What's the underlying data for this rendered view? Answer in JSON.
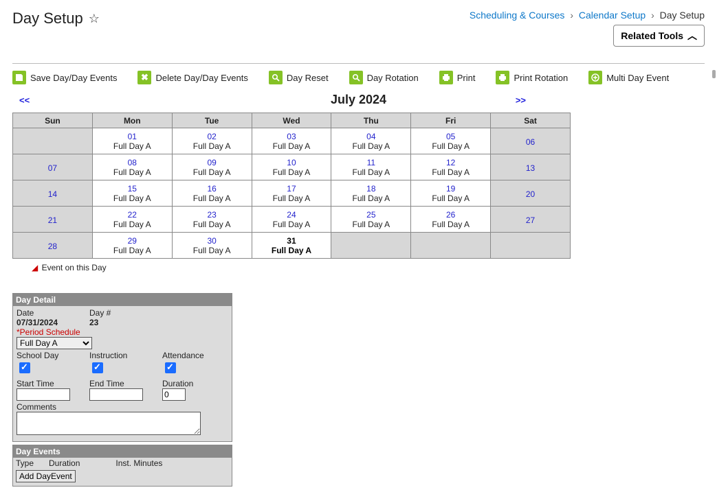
{
  "page_title": "Day Setup",
  "breadcrumb": {
    "scheduling": "Scheduling & Courses",
    "calendar_setup": "Calendar Setup",
    "day_setup": "Day Setup"
  },
  "related_tools_label": "Related Tools",
  "toolbar": {
    "save": "Save Day/Day Events",
    "delete": "Delete Day/Day Events",
    "day_reset": "Day Reset",
    "day_rotation": "Day Rotation",
    "print": "Print",
    "print_rotation": "Print Rotation",
    "multi_day_event": "Multi Day Event"
  },
  "calendar": {
    "month_label": "July 2024",
    "prev_symbol": "<<",
    "next_symbol": ">>",
    "weekdays": [
      "Sun",
      "Mon",
      "Tue",
      "Wed",
      "Thu",
      "Fri",
      "Sat"
    ],
    "weeks": [
      [
        {
          "n": "",
          "label": "",
          "weekend": true
        },
        {
          "n": "01",
          "label": "Full Day A"
        },
        {
          "n": "02",
          "label": "Full Day A"
        },
        {
          "n": "03",
          "label": "Full Day A"
        },
        {
          "n": "04",
          "label": "Full Day A"
        },
        {
          "n": "05",
          "label": "Full Day A"
        },
        {
          "n": "06",
          "label": "",
          "weekend": true
        }
      ],
      [
        {
          "n": "07",
          "label": "",
          "weekend": true
        },
        {
          "n": "08",
          "label": "Full Day A"
        },
        {
          "n": "09",
          "label": "Full Day A"
        },
        {
          "n": "10",
          "label": "Full Day A"
        },
        {
          "n": "11",
          "label": "Full Day A"
        },
        {
          "n": "12",
          "label": "Full Day A"
        },
        {
          "n": "13",
          "label": "",
          "weekend": true
        }
      ],
      [
        {
          "n": "14",
          "label": "",
          "weekend": true
        },
        {
          "n": "15",
          "label": "Full Day A"
        },
        {
          "n": "16",
          "label": "Full Day A"
        },
        {
          "n": "17",
          "label": "Full Day A"
        },
        {
          "n": "18",
          "label": "Full Day A"
        },
        {
          "n": "19",
          "label": "Full Day A"
        },
        {
          "n": "20",
          "label": "",
          "weekend": true
        }
      ],
      [
        {
          "n": "21",
          "label": "",
          "weekend": true
        },
        {
          "n": "22",
          "label": "Full Day A"
        },
        {
          "n": "23",
          "label": "Full Day A"
        },
        {
          "n": "24",
          "label": "Full Day A"
        },
        {
          "n": "25",
          "label": "Full Day A"
        },
        {
          "n": "26",
          "label": "Full Day A"
        },
        {
          "n": "27",
          "label": "",
          "weekend": true
        }
      ],
      [
        {
          "n": "28",
          "label": "",
          "weekend": true
        },
        {
          "n": "29",
          "label": "Full Day A"
        },
        {
          "n": "30",
          "label": "Full Day A"
        },
        {
          "n": "31",
          "label": "Full Day A",
          "selected": true
        },
        {
          "n": "",
          "label": "",
          "other": true
        },
        {
          "n": "",
          "label": "",
          "other": true
        },
        {
          "n": "",
          "label": "",
          "other": true
        }
      ]
    ]
  },
  "legend": "Event on this Day",
  "day_detail": {
    "panel_title": "Day Detail",
    "date_label": "Date",
    "date_value": "07/31/2024",
    "daynum_label": "Day #",
    "daynum_value": "23",
    "period_schedule_label": "*Period Schedule",
    "period_schedule_value": "Full Day A",
    "school_day_label": "School Day",
    "instruction_label": "Instruction",
    "attendance_label": "Attendance",
    "start_time_label": "Start Time",
    "start_time_value": "",
    "end_time_label": "End Time",
    "end_time_value": "",
    "duration_label": "Duration",
    "duration_value": "0",
    "comments_label": "Comments",
    "comments_value": ""
  },
  "day_events": {
    "panel_title": "Day Events",
    "col_type": "Type",
    "col_duration": "Duration",
    "col_inst_minutes": "Inst. Minutes",
    "add_button": "Add DayEvent"
  }
}
